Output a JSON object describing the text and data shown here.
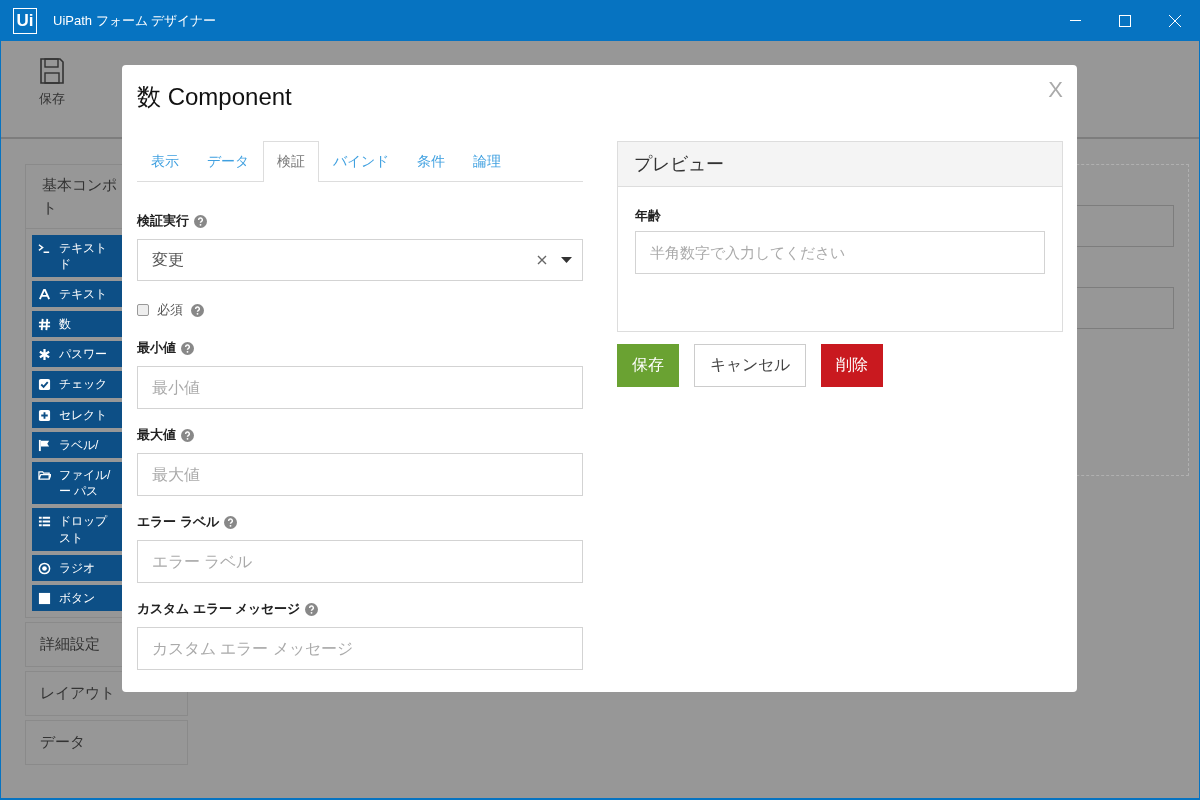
{
  "window": {
    "logo": "Ui",
    "title": "UiPath フォーム デザイナー"
  },
  "toolbar": {
    "items": [
      {
        "label": "保存"
      }
    ]
  },
  "sidebar": {
    "panels": [
      {
        "title": "基本コンポト",
        "expanded": true,
        "items": [
          {
            "label": "テキストド"
          },
          {
            "label": "テキスト"
          },
          {
            "label": "数"
          },
          {
            "label": "パスワー"
          },
          {
            "label": "チェック"
          },
          {
            "label": "セレクト"
          },
          {
            "label": "ラベル/"
          },
          {
            "label": "ファイル/ー パス"
          },
          {
            "label": "ドロップスト"
          },
          {
            "label": "ラジオ"
          },
          {
            "label": "ボタン"
          }
        ]
      },
      {
        "title": "詳細設定",
        "expanded": false
      },
      {
        "title": "レイアウト",
        "expanded": false
      },
      {
        "title": "データ",
        "expanded": false
      }
    ]
  },
  "dialog": {
    "title": "数 Component",
    "close": "X",
    "tabs": [
      {
        "label": "表示",
        "selected": false
      },
      {
        "label": "データ",
        "selected": false
      },
      {
        "label": "検証",
        "selected": true
      },
      {
        "label": "バインド",
        "selected": false
      },
      {
        "label": "条件",
        "selected": false
      },
      {
        "label": "論理",
        "selected": false
      }
    ],
    "fields": [
      {
        "kind": "select",
        "label": "検証実行",
        "value": "変更"
      },
      {
        "kind": "checkbox",
        "label": "必須",
        "checked": false
      },
      {
        "kind": "text",
        "label": "最小値",
        "placeholder": "最小値"
      },
      {
        "kind": "text",
        "label": "最大値",
        "placeholder": "最大値"
      },
      {
        "kind": "text",
        "label": "エラー ラベル",
        "placeholder": "エラー ラベル"
      },
      {
        "kind": "text",
        "label": "カスタム エラー メッセージ",
        "placeholder": "カスタム エラー メッセージ"
      }
    ],
    "preview": {
      "title": "プレビュー",
      "label": "年齢",
      "placeholder": "半角数字で入力してください"
    },
    "buttons": [
      {
        "kind": "primary",
        "label": "保存"
      },
      {
        "kind": "default",
        "label": "キャンセル"
      },
      {
        "kind": "danger",
        "label": "削除"
      }
    ]
  }
}
